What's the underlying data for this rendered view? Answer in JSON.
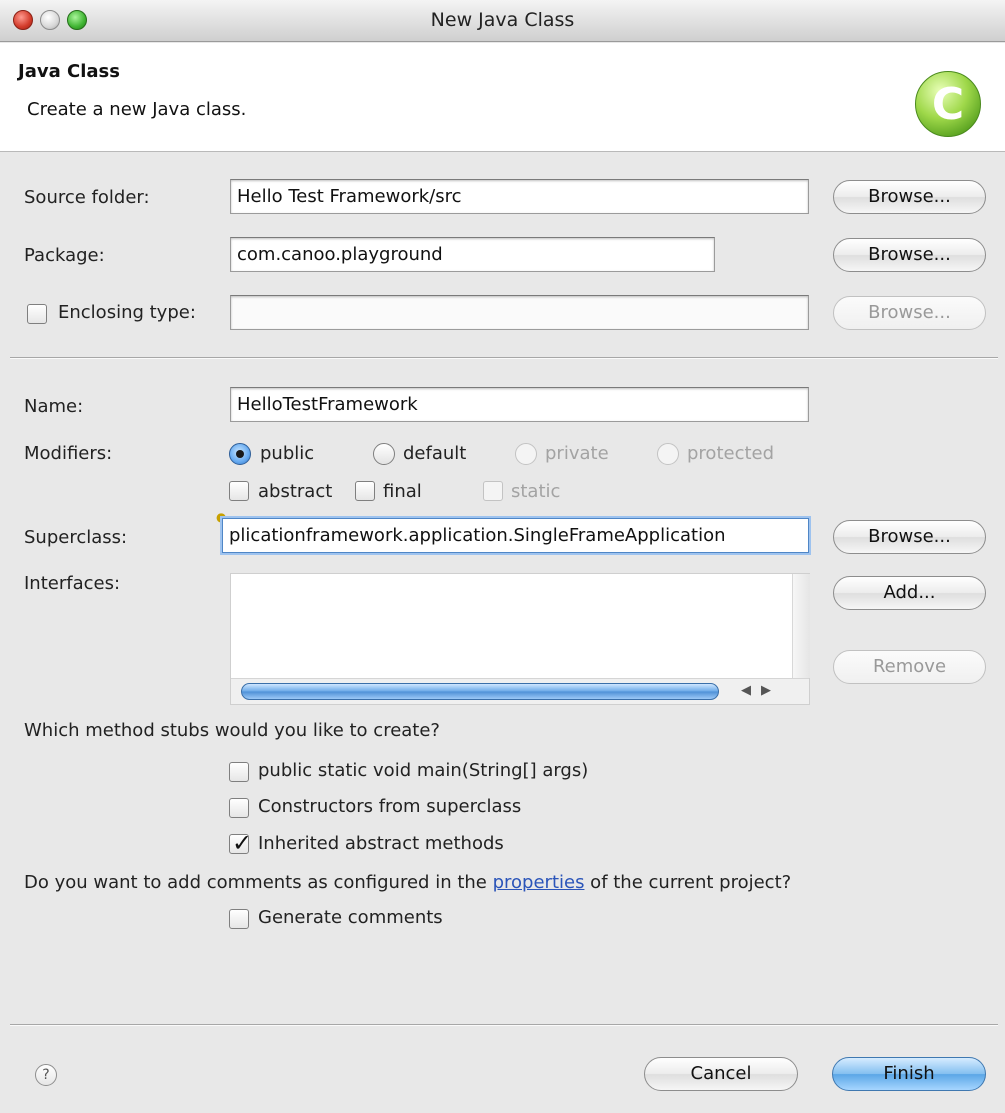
{
  "window": {
    "title": "New Java Class"
  },
  "header": {
    "title": "Java Class",
    "description": "Create a new Java class.",
    "icon": "class-c-icon",
    "icon_letter": "C"
  },
  "form": {
    "source_folder": {
      "label": "Source folder:",
      "value": "Hello Test Framework/src",
      "button": "Browse..."
    },
    "package": {
      "label": "Package:",
      "value": "com.canoo.playground",
      "button": "Browse..."
    },
    "enclosing_type": {
      "label": "Enclosing type:",
      "value": "",
      "checked": false,
      "button": "Browse..."
    },
    "name": {
      "label": "Name:",
      "value": "HelloTestFramework"
    },
    "modifiers": {
      "label": "Modifiers:",
      "access": [
        {
          "label": "public",
          "selected": true,
          "enabled": true
        },
        {
          "label": "default",
          "selected": false,
          "enabled": true
        },
        {
          "label": "private",
          "selected": false,
          "enabled": false
        },
        {
          "label": "protected",
          "selected": false,
          "enabled": false
        }
      ],
      "flags": [
        {
          "label": "abstract",
          "checked": false,
          "enabled": true
        },
        {
          "label": "final",
          "checked": false,
          "enabled": true
        },
        {
          "label": "static",
          "checked": false,
          "enabled": false
        }
      ]
    },
    "superclass": {
      "label": "Superclass:",
      "value": "plicationframework.application.SingleFrameApplication",
      "button": "Browse..."
    },
    "interfaces": {
      "label": "Interfaces:",
      "add_button": "Add...",
      "remove_button": "Remove",
      "items": []
    }
  },
  "stubs": {
    "question": "Which method stubs would you like to create?",
    "options": [
      {
        "label": "public static void main(String[] args)",
        "checked": false
      },
      {
        "label": "Constructors from superclass",
        "checked": false
      },
      {
        "label": "Inherited abstract methods",
        "checked": true
      }
    ]
  },
  "comments": {
    "question_prefix": "Do you want to add comments as configured in the ",
    "link": "properties",
    "question_suffix": " of the current project?",
    "option": {
      "label": "Generate comments",
      "checked": false
    }
  },
  "footer": {
    "help": "?",
    "cancel": "Cancel",
    "finish": "Finish"
  },
  "colors": {
    "default_button": "#5aa6e6",
    "link": "#2a54b9",
    "header_bg": "#ffffff",
    "dialog_bg": "#e8e8e8"
  }
}
